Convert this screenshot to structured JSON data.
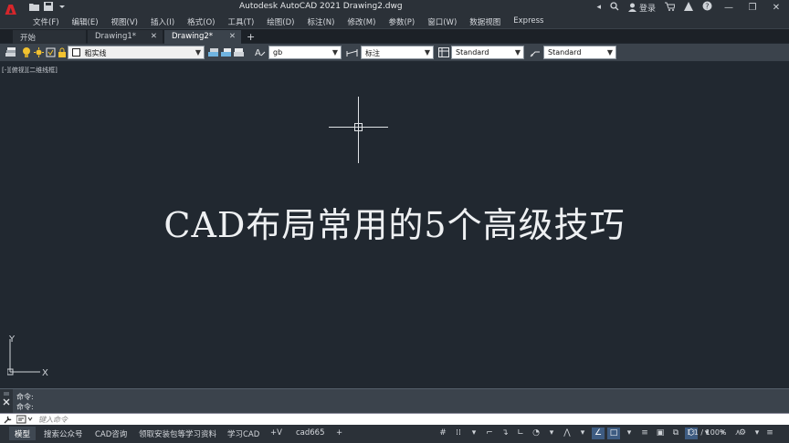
{
  "titlebar": {
    "title": "Autodesk AutoCAD 2021    Drawing2.dwg",
    "login": "登录",
    "icons": [
      "open-icon",
      "save-icon",
      "search-icon",
      "user-icon",
      "cart-icon",
      "help-icon",
      "minimize-icon",
      "maximize-icon",
      "close-icon"
    ]
  },
  "menu": {
    "items": [
      "文件(F)",
      "编辑(E)",
      "视图(V)",
      "插入(I)",
      "格式(O)",
      "工具(T)",
      "绘图(D)",
      "标注(N)",
      "修改(M)",
      "参数(P)",
      "窗口(W)",
      "数据视图",
      "Express"
    ]
  },
  "tabs": {
    "items": [
      {
        "label": "开始"
      },
      {
        "label": "Drawing1*"
      },
      {
        "label": "Drawing2*"
      }
    ],
    "plus": "+",
    "close": "✕"
  },
  "properties": {
    "layer_value": "粗实线",
    "text_style": "gb",
    "dim_style": "标注",
    "table_style": "Standard",
    "mleader_style": "Standard"
  },
  "drawing": {
    "viewport_label": "[-][俯视][二维线框]",
    "headline": "CAD布局常用的5个高级技巧",
    "ucs_x": "X",
    "ucs_y": "Y"
  },
  "command": {
    "history": [
      "命令:",
      "命令:"
    ],
    "placeholder": "键入命令"
  },
  "status": {
    "tabs": [
      "模型",
      "搜索公众号",
      "CAD咨询",
      "领取安装包等学习资料",
      "学习CAD",
      "+V",
      "cad665"
    ],
    "plus": "+",
    "scale": "1:1 / 100%"
  },
  "colors": {
    "canvas": "#212830",
    "chrome": "#2b3138",
    "toolbar": "#3b434c",
    "accent": "#3e5c82",
    "logo": "#d7262b"
  }
}
